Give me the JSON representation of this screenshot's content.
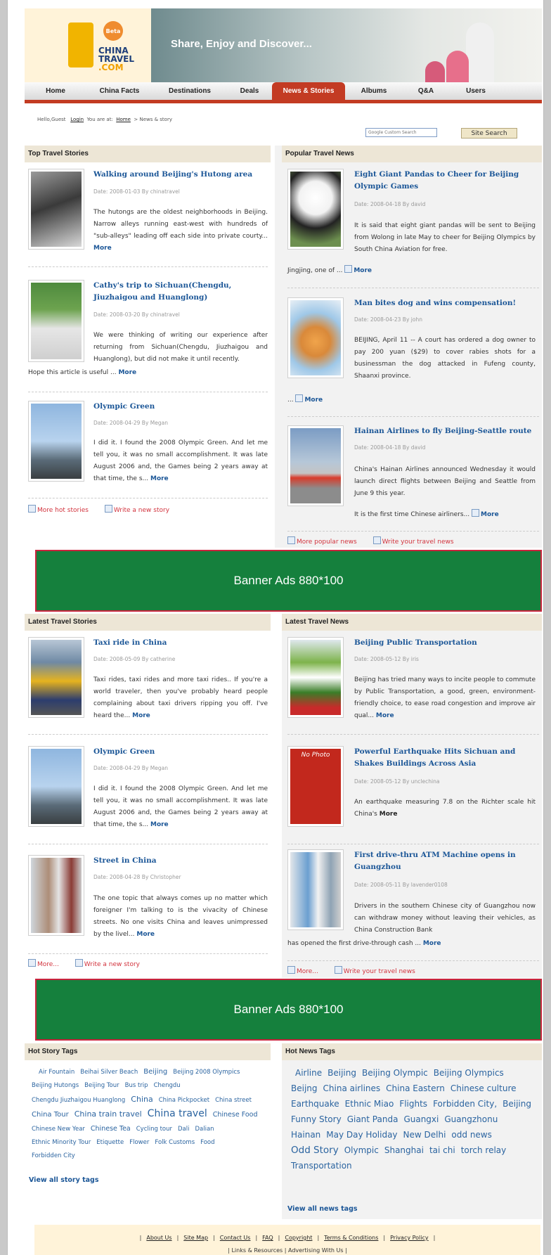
{
  "brand": {
    "beta": "Beta",
    "logo_line1": "CHINA",
    "logo_line2": "TRAVEL",
    "logo_line3": ".COM",
    "slogan": "Share, Enjoy and Discover..."
  },
  "nav": [
    "Home",
    "China Facts",
    "Destinations",
    "Deals",
    "News & Stories",
    "Albums",
    "Q&A",
    "Users"
  ],
  "nav_active": "News & Stories",
  "crumb": {
    "hello": "Hello,Guest",
    "login": "Login",
    "you_are_at": "You are at:",
    "home": "Home",
    "current": "> News & story"
  },
  "search": {
    "placeholder": "Google Custom Search",
    "button": "Site Search"
  },
  "top_stories": {
    "heading": "Top Travel Stories",
    "items": [
      {
        "title": "Walking around Beijing's Hutong area",
        "date": "Date: 2008-01-03 By chinatravel",
        "text": "The hutongs are the oldest neighborhoods in Beijing. Narrow alleys running east-west with hundreds of \"sub-alleys\" leading off each side into private courty...",
        "more": "More",
        "tail": ""
      },
      {
        "title": "Cathy's trip to Sichuan(Chengdu, Jiuzhaigou and Huanglong)",
        "date": "Date: 2008-03-20 By chinatravel",
        "text": "We were thinking of writing our experience after returning from Sichuan(Chengdu, Jiuzhaigou and Huanglong), but did not make it until recently.",
        "more": "More",
        "tail": "Hope this article is useful ..."
      },
      {
        "title": "Olympic Green",
        "date": "Date: 2008-04-29 By Megan",
        "text": "I did it. I found the 2008 Olympic Green. And let me tell you, it was no small accomplishment. It was late August 2006 and, the Games being 2 years away at that time, the s...",
        "more": "More",
        "tail": ""
      }
    ],
    "links": [
      "More hot stories",
      "Write a new story"
    ]
  },
  "popular_news": {
    "heading": "Popular Travel News",
    "items": [
      {
        "title": "Eight Giant Pandas to Cheer for Beijing Olympic Games",
        "date": "Date: 2008-04-18 By david",
        "text": "It is said that eight giant pandas will be sent to Beijing from Wolong in late May to cheer for Beijing Olympics by South China Aviation for free.",
        "tail": "Jingjing, one of ...",
        "more": "More"
      },
      {
        "title": "Man bites dog and wins compensation!",
        "date": "Date: 2008-04-23 By john",
        "text": "BEIJING, April 11 -- A court has ordered a dog owner to pay 200 yuan ($29) to cover rabies shots for a businessman the dog attacked in Fufeng county, Shaanxi province.",
        "tail": "...",
        "more": "More"
      },
      {
        "title": "Hainan Airlines to fly Beijing-Seattle route",
        "date": "Date: 2008-04-18 By david",
        "text": "China's Hainan Airlines announced Wednesday it would launch direct flights between Beijing and Seattle from June 9 this year.",
        "tail": "It is the first time Chinese airliners...",
        "more": "More"
      }
    ],
    "links": [
      "More popular news",
      "Write your travel news"
    ]
  },
  "banner1": "Banner Ads 880*100",
  "latest_stories": {
    "heading": "Latest Travel Stories",
    "items": [
      {
        "title": "Taxi ride in China",
        "date": "Date: 2008-05-09 By catherine",
        "text": "Taxi rides, taxi rides and more taxi rides.. If you're a world traveler, then you've probably heard people complaining about taxi drivers ripping you off. I've heard the...",
        "more": "More"
      },
      {
        "title": "Olympic Green",
        "date": "Date: 2008-04-29 By Megan",
        "text": "I did it. I found the 2008 Olympic Green. And let me tell you, it was no small accomplishment. It was late August 2006 and, the Games being 2 years away at that time, the s...",
        "more": "More"
      },
      {
        "title": "Street in China",
        "date": "Date: 2008-04-28 By Christopher",
        "text": "The one topic that always comes up no matter which foreigner I'm talking to is the vivacity of Chinese streets. No one visits China and leaves unimpressed by the livel...",
        "more": "More"
      }
    ],
    "links": [
      "More...",
      "Write a new story"
    ]
  },
  "latest_news": {
    "heading": "Latest Travel News",
    "nophoto": "No Photo",
    "items": [
      {
        "title": "Beijing Public Transportation",
        "date": "Date: 2008-05-12 By iris",
        "text": "Beijing has tried many ways to incite people to commute by Public Transportation, a good, green, environment-friendly choice, to ease road congestion and improve air qual...",
        "tail": "",
        "more": "More"
      },
      {
        "title": "Powerful Earthquake Hits Sichuan and Shakes Buildings Across Asia",
        "date": "Date: 2008-05-12 By unclechina",
        "text": "An earthquake measuring 7.8 on the Richter scale hit China's",
        "tail": "",
        "more": "More"
      },
      {
        "title": "First drive-thru ATM Machine opens in Guangzhou",
        "date": "Date: 2008-05-11 By lavender0108",
        "text": "Drivers in the southern Chinese city of Guangzhou now can withdraw money without leaving their vehicles, as China Construction Bank",
        "tail": "has opened the first drive-through cash ...",
        "more": "More"
      }
    ],
    "links": [
      "More...",
      "Write your travel news"
    ]
  },
  "banner2": "Banner Ads 880*100",
  "story_tags": {
    "heading": "Hot Story Tags",
    "tags": [
      "Air Fountain",
      "Beihai Silver Beach",
      "Beijing",
      "Beijing 2008 Olympics",
      "Beijing Hutongs",
      "Beijing Tour",
      "Bus trip",
      "Chengdu",
      "Chengdu Jiuzhaigou Huanglong",
      "China",
      "China Pickpocket",
      "China street",
      "China Tour",
      "China train travel",
      "China travel",
      "Chinese Food",
      "Chinese New Year",
      "Chinese Tea",
      "Cycling tour",
      "Dali",
      "Dalian",
      "Ethnic Minority Tour",
      "Etiquette",
      "Flower",
      "Folk Customs",
      "Food",
      "Forbidden City"
    ],
    "view_all": "View all story tags"
  },
  "news_tags": {
    "heading": "Hot News Tags",
    "tags": [
      "Airline",
      "Beijing",
      "Beijing Olympic",
      "Beijing Olympics",
      "Beijng",
      "China airlines",
      "China Eastern",
      "Chinese culture",
      "Earthquake",
      "Ethnic Miao",
      "Flights",
      "Forbidden City,",
      "Beijing",
      "Funny Story",
      "Giant Panda",
      "Guangxi",
      "Guangzhonu",
      "Hainan",
      "May Day Holiday",
      "New Delhi",
      "odd news",
      "Odd Story",
      "Olympic",
      "Shanghai",
      "tai chi",
      "torch relay",
      "Transportation"
    ],
    "view_all": "View all news tags"
  },
  "footer": {
    "links": [
      "About Us",
      "Site Map",
      "Contact Us",
      "FAQ",
      "Copyright",
      "Terms & Conditions",
      "Privacy Policy"
    ],
    "links2": [
      "Links & Resources",
      "Advertising With Us"
    ]
  }
}
